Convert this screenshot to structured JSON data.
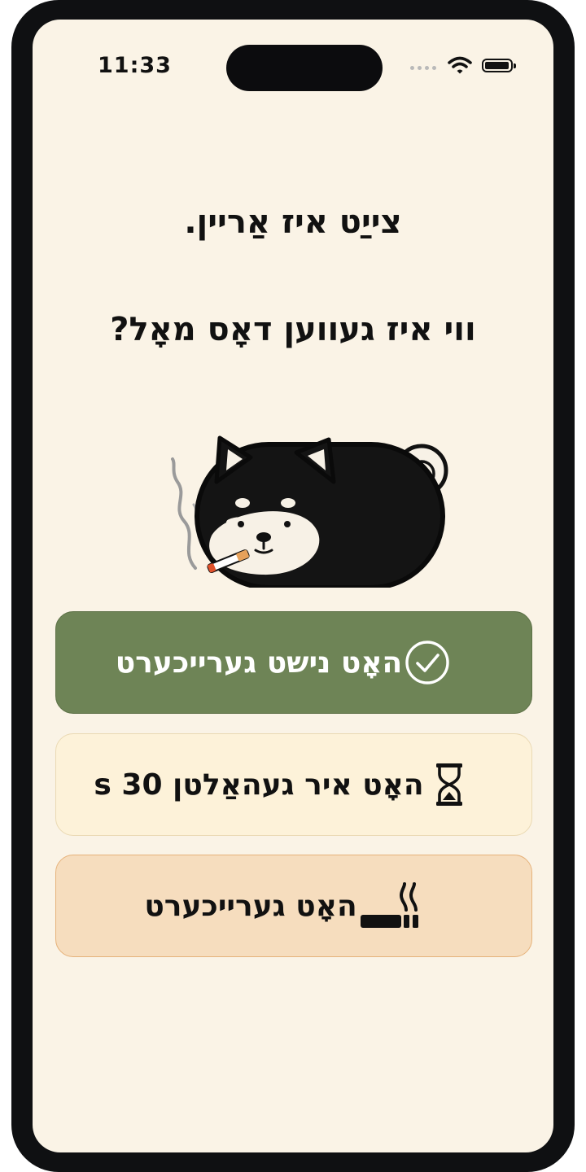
{
  "status_bar": {
    "time": "11:33"
  },
  "prompt": {
    "line1": "צייַט איז אַריין.",
    "line2": "ווי איז געווען דאָס מאָל?"
  },
  "options": [
    {
      "label": "האָט נישט גערייכערט",
      "icon": "check-circle-icon"
    },
    {
      "label": "האָט איר געהאַלטן 30 s",
      "icon": "hourglass-icon"
    },
    {
      "label": "האָט גערייכערט",
      "icon": "cigarette-icon"
    }
  ],
  "colors": {
    "background": "#faf3e6",
    "option_success": "#6e8456",
    "option_neutral": "#fdf2d9",
    "option_warning": "#f6ddbe"
  }
}
